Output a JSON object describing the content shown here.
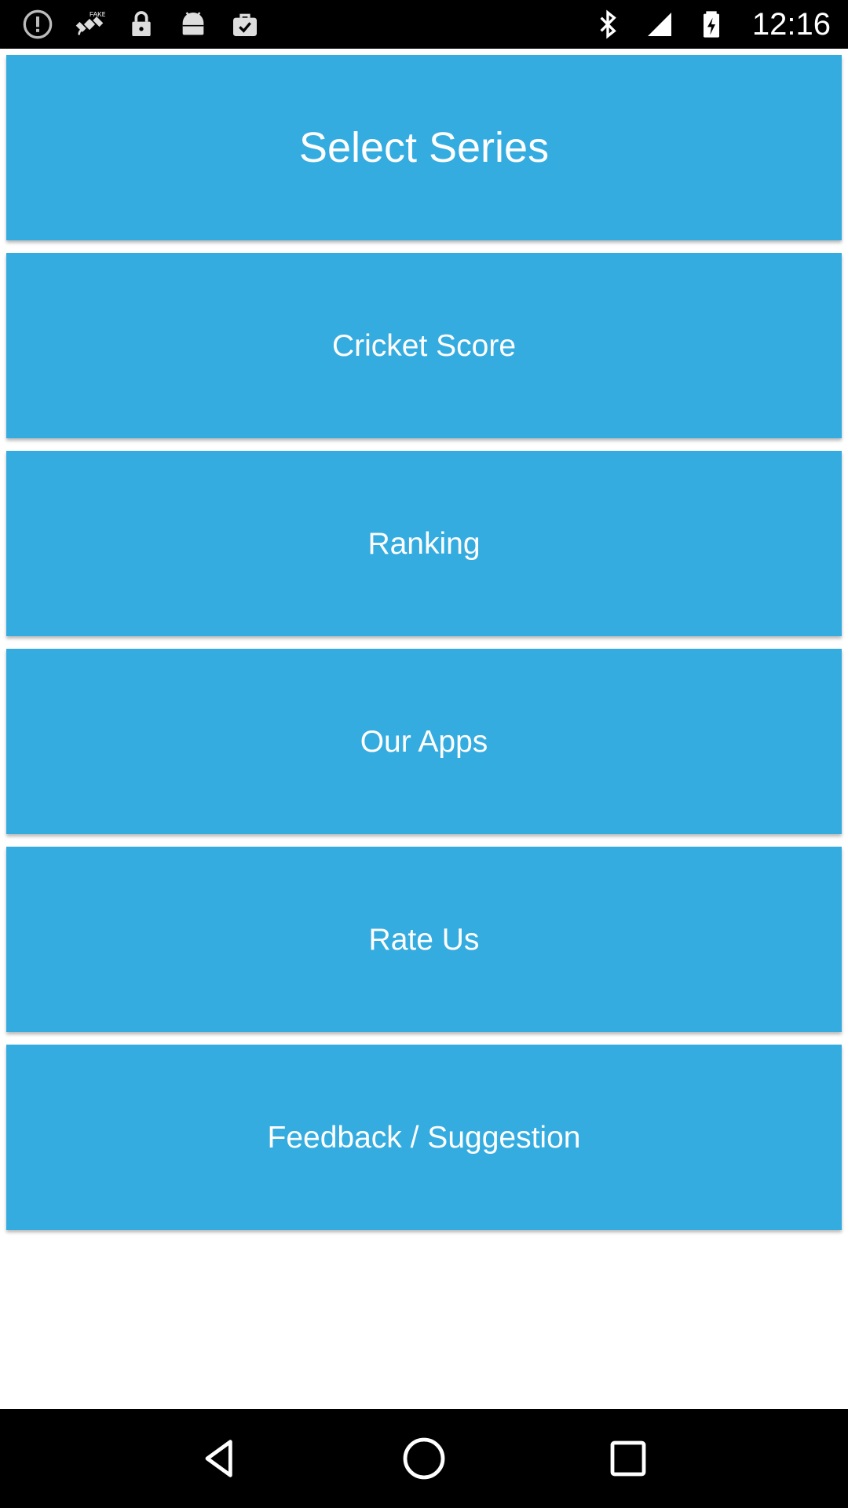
{
  "status_bar": {
    "time": "12:16",
    "left_icons": [
      "alert-circle-icon",
      "fake-gps-icon",
      "lock-icon",
      "android-icon",
      "briefcase-check-icon"
    ],
    "right_icons": [
      "bluetooth-icon",
      "signal-icon",
      "battery-icon"
    ]
  },
  "menu": {
    "items": [
      {
        "label": "Select Series"
      },
      {
        "label": "Cricket Score"
      },
      {
        "label": "Ranking"
      },
      {
        "label": "Our Apps"
      },
      {
        "label": "Rate Us"
      },
      {
        "label": "Feedback / Suggestion"
      }
    ]
  },
  "nav_bar": {
    "buttons": [
      "back-icon",
      "home-icon",
      "recents-icon"
    ]
  },
  "colors": {
    "button_bg": "#35ace0",
    "button_text": "#ffffff",
    "bars": "#000000",
    "page_bg": "#ffffff"
  }
}
